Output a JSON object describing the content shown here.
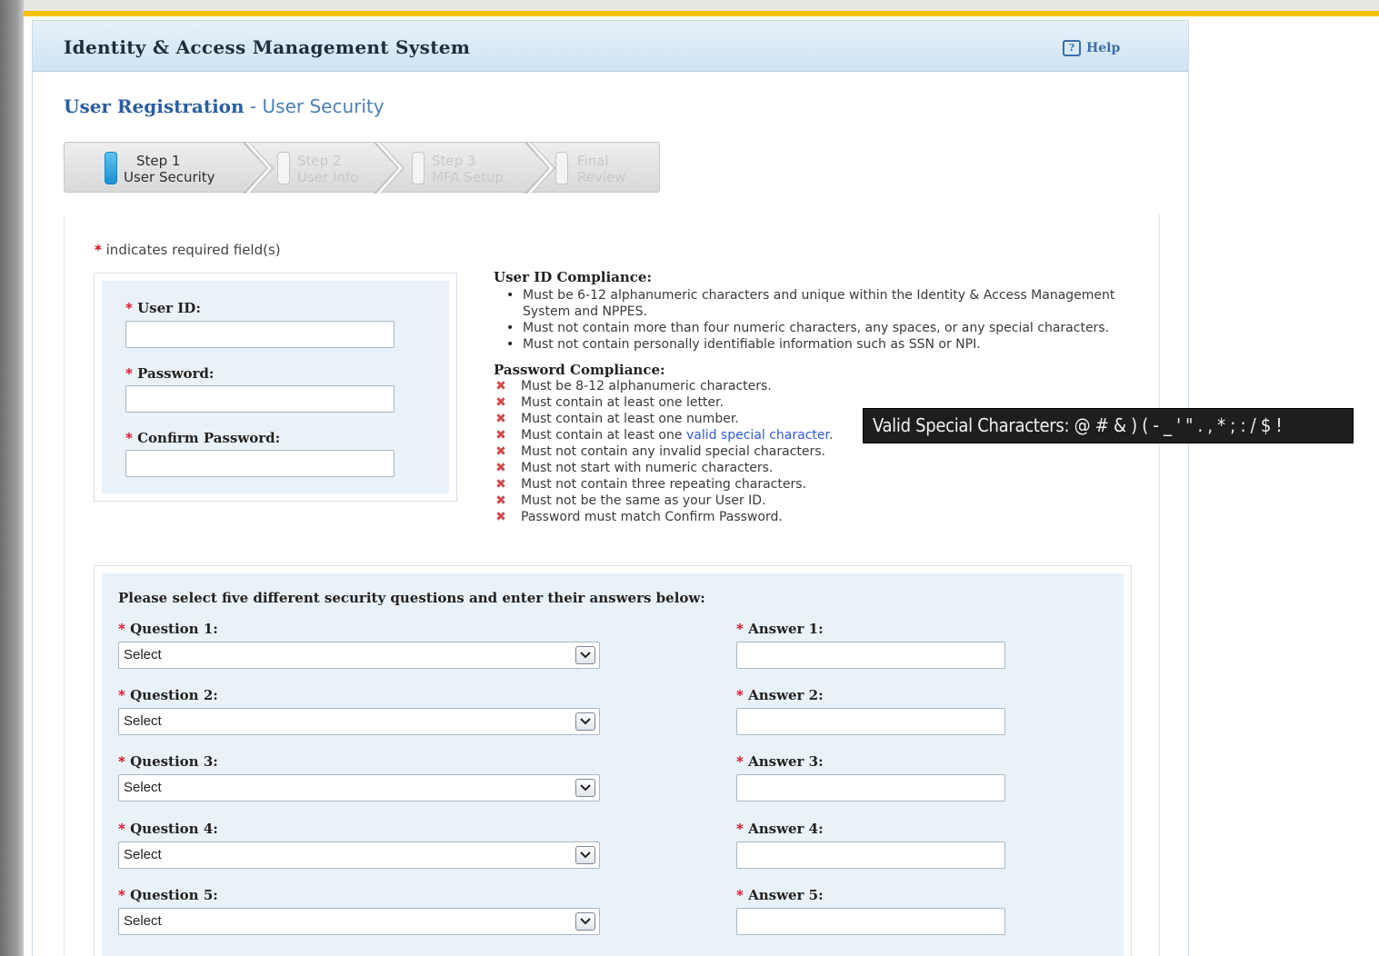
{
  "header": {
    "title": "Identity & Access Management System",
    "help_label": "Help",
    "help_icon": "?"
  },
  "page": {
    "heading_main": "User Registration",
    "heading_sep": " - ",
    "heading_sub": "User Security"
  },
  "steps": [
    {
      "line1": "Step 1",
      "line2": "User Security",
      "active": true
    },
    {
      "line1": "Step 2",
      "line2": "User Info",
      "active": false
    },
    {
      "line1": "Step 3",
      "line2": "MFA Setup",
      "active": false
    },
    {
      "line1": "Final",
      "line2": "Review",
      "active": false
    }
  ],
  "required_note": {
    "star": "*",
    "text": "indicates required field(s)"
  },
  "credentials": {
    "user_id_label": "User ID:",
    "user_id_value": "",
    "password_label": "Password:",
    "password_value": "",
    "confirm_label": "Confirm Password:",
    "confirm_value": ""
  },
  "user_id_compliance": {
    "title": "User ID Compliance:",
    "rules": [
      "Must be 6-12 alphanumeric characters and unique within the Identity & Access Management System and NPPES.",
      "Must not contain more than four numeric characters, any spaces, or any special characters.",
      "Must not contain personally identifiable information such as SSN or NPI."
    ]
  },
  "password_compliance": {
    "title": "Password Compliance:",
    "status_icon": "x-icon",
    "rules": [
      "Must be 8-12 alphanumeric characters.",
      "Must contain at least one letter.",
      "Must contain at least one number.",
      "Must contain at least one",
      "Must not contain any invalid special characters.",
      "Must not start with numeric characters.",
      "Must not contain three repeating characters.",
      "Must not be the same as your User ID.",
      "Password must match Confirm Password."
    ],
    "special_link": "valid special character",
    "special_suffix": "."
  },
  "tooltip": {
    "text": "Valid Special Characters: @ # & ) ( - _ ' \" . , * ; : / $ !"
  },
  "security_questions": {
    "intro": "Please select five different security questions and enter their answers below:",
    "items": [
      {
        "question_label": "Question 1:",
        "selected": "Select",
        "answer_label": "Answer 1:",
        "answer_value": ""
      },
      {
        "question_label": "Question 2:",
        "selected": "Select",
        "answer_label": "Answer 2:",
        "answer_value": ""
      },
      {
        "question_label": "Question 3:",
        "selected": "Select",
        "answer_label": "Answer 3:",
        "answer_value": ""
      },
      {
        "question_label": "Question 4:",
        "selected": "Select",
        "answer_label": "Answer 4:",
        "answer_value": ""
      },
      {
        "question_label": "Question 5:",
        "selected": "Select",
        "answer_label": "Answer 5:",
        "answer_value": ""
      }
    ]
  },
  "colors": {
    "accent": "#2a5d9f",
    "required_star": "#d0021b",
    "fail_icon": "#d14b4b",
    "active_step": "#1a8fd1"
  }
}
